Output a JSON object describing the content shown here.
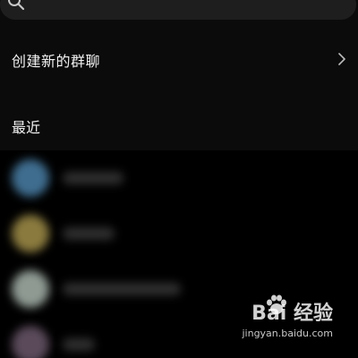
{
  "search": {
    "icon": "search-icon"
  },
  "create_group": {
    "label": "创建新的群聊",
    "icon": "chevron-right-icon"
  },
  "recent": {
    "label": "最近"
  },
  "contacts": [
    {
      "avatar_color": "#3f6d8f"
    },
    {
      "avatar_color": "#8a7a3e"
    },
    {
      "avatar_color": "#8f9a93"
    },
    {
      "avatar_color": "#5a4a5a"
    }
  ],
  "watermark": {
    "logo_text": "Bai 经验",
    "url": "jingyan.baidu.com"
  }
}
